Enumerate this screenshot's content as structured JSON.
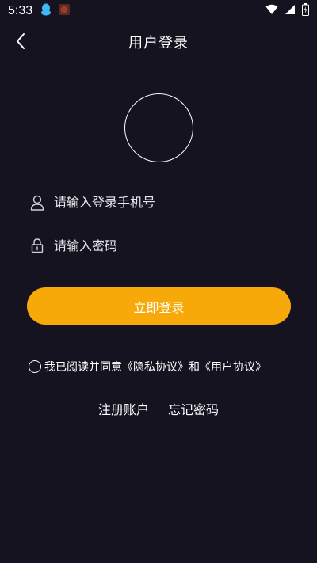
{
  "status_bar": {
    "time": "5:33"
  },
  "header": {
    "title": "用户登录"
  },
  "form": {
    "phone_placeholder": "请输入登录手机号",
    "password_placeholder": "请输入密码",
    "login_label": "立即登录"
  },
  "agreement": {
    "prefix": "我已阅读并同意",
    "privacy": "《隐私协议》",
    "connector": "和",
    "user": "《用户协议》"
  },
  "links": {
    "register": "注册账户",
    "forgot": "忘记密码"
  },
  "colors": {
    "background": "#14131f",
    "accent": "#f7a90a"
  }
}
